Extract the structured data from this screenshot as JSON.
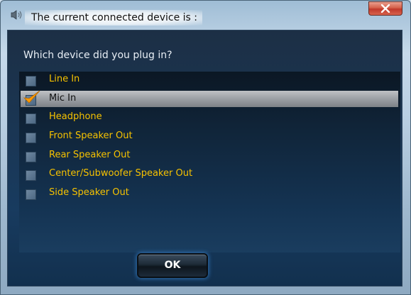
{
  "window": {
    "title": "The current connected device is :",
    "close_label": "X"
  },
  "dialog": {
    "prompt": "Which device did you plug in?",
    "devices": [
      {
        "label": "Line In",
        "checked": false
      },
      {
        "label": "Mic In",
        "checked": true
      },
      {
        "label": "Headphone",
        "checked": false
      },
      {
        "label": "Front Speaker Out",
        "checked": false
      },
      {
        "label": "Rear Speaker Out",
        "checked": false
      },
      {
        "label": "Center/Subwoofer Speaker Out",
        "checked": false
      },
      {
        "label": "Side Speaker Out",
        "checked": false
      }
    ],
    "ok_label": "OK"
  },
  "colors": {
    "item_text": "#f6c200",
    "selected_item_text": "#101010",
    "checkmark": "#ff9a00"
  },
  "icons": {
    "title_icon": "speaker-icon",
    "close_icon": "close-icon",
    "check_icon": "checkmark-icon"
  }
}
